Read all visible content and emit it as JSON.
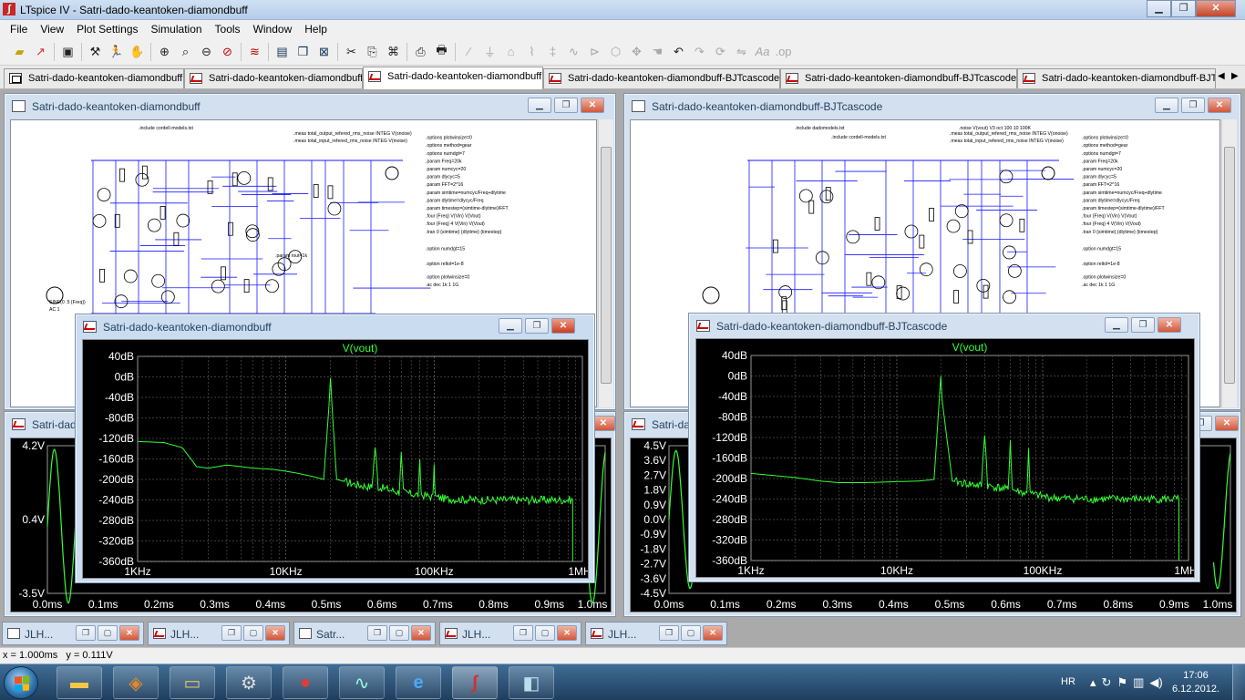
{
  "app": {
    "title": "LTspice IV - Satri-dado-keantoken-diamondbuff"
  },
  "menu": [
    "File",
    "View",
    "Plot Settings",
    "Simulation",
    "Tools",
    "Window",
    "Help"
  ],
  "toolbar": {
    "icons": [
      "open-folder-icon",
      "open-file-icon",
      "save-icon",
      "control-panel-icon",
      "run-icon",
      "halt-icon",
      "zoom-in-icon",
      "zoom-pan-icon",
      "zoom-out-icon",
      "zoom-cancel-icon",
      "autorange-icon",
      "tile-horizontal-icon",
      "cascade-icon",
      "close-window-icon",
      "cut-icon",
      "copy-icon",
      "find-icon",
      "print-setup-icon",
      "print-icon",
      "wire-icon",
      "ground-icon",
      "label-icon",
      "resistor-icon",
      "capacitor-icon",
      "inductor-icon",
      "diode-icon",
      "component-icon",
      "move-icon",
      "drag-icon",
      "undo-icon",
      "redo-icon",
      "rotate-icon",
      "mirror-icon",
      "text-icon",
      "spice-directive-icon"
    ]
  },
  "tabs": [
    {
      "label": "Satri-dado-keantoken-diamondbuff",
      "type": "sch"
    },
    {
      "label": "Satri-dado-keantoken-diamondbuff",
      "type": "plot"
    },
    {
      "label": "Satri-dado-keantoken-diamondbuff",
      "type": "plot"
    },
    {
      "label": "Satri-dado-keantoken-diamondbuff-BJTcascode",
      "type": "plot"
    },
    {
      "label": "Satri-dado-keantoken-diamondbuff-BJTcascode",
      "type": "plot"
    },
    {
      "label": "Satri-dado-keantoken-diamondbuff-BJTc",
      "type": "plot"
    }
  ],
  "windows": {
    "schematic_left": {
      "title": "Satri-dado-keantoken-diamondbuff",
      "directives": [
        ".include cordell-models.txt",
        ".meas total_output_refered_rms_noise INTEG V(onoise)",
        ".meas total_input_refered_rms_noise INTEG V(inoise)",
        ".options plotwinsize=0",
        ".options method=gear",
        ".options numdgt=7",
        ".param Freq=20k",
        ".param numcyc=20",
        ".param dlycyc=5",
        ".param FFT=2^16",
        ".param simtime=numcyc/Freq+dlytime",
        ".param dlytime=dlycyc/Freq",
        ".param timestep=(simtime-dlytime)/FFT",
        ".four {Freq} V(Vin) V(Vout)",
        ".four {Freq} 4 V(Vin) V(Vout)",
        ".tran 0 {simtime} {dlytime} {timestep}",
        ".option numdgt=15",
        ".option reltol=1e-8",
        ".option plotwinsize=0",
        ".ac dec 1k 1 1G",
        ".param rout=1k",
        "SINE(0 .5 {Freq})",
        "AC 1"
      ]
    },
    "schematic_right": {
      "title": "Satri-dado-keantoken-diamondbuff-BJTcascode",
      "directives": [
        ".include dadomodels.txt",
        ".noise V(vout) V3 oct 100 10 100K",
        ".include cordell-models.txt",
        ".meas total_output_refered_rms_noise INTEG V(onoise)",
        ".meas total_input_refered_rms_noise INTEG V(inoise)",
        ".options plotwinsize=0",
        ".options method=gear",
        ".options numdgt=7",
        ".param Freq=20k",
        ".param numcyc=20",
        ".param dlycyc=5",
        ".param FFT=2^16",
        ".param simtime=numcyc/Freq+dlytime",
        ".param dlytime=dlycyc/Freq",
        ".param timestep=(simtime-dlytime)/FFT",
        ".four {Freq} V(Vin) V(Vout)",
        ".four {Freq} 4 V(Vin) V(Vout)",
        ".tran 0 {simtime} {dlytime} {timestep}",
        ".option numdgt=15",
        ".option reltol=1e-8",
        ".option plotwinsize=0",
        ".ac dec 1k 1 1G"
      ]
    },
    "time_left": {
      "title": "Satri-dad",
      "ylabels": [
        "4.2V",
        "0.4V",
        "-3.5V"
      ],
      "xlabels": [
        "0.0ms",
        "0.1ms",
        "0.2ms",
        "0.3ms",
        "0.4ms",
        "0.5ms",
        "0.6ms",
        "0.7ms",
        "0.8ms",
        "0.9ms",
        "1.0ms"
      ]
    },
    "time_right": {
      "title": "Satri-dad",
      "ylabels": [
        "4.5V",
        "3.6V",
        "2.7V",
        "1.8V",
        "0.9V",
        "0.0V",
        "-0.9V",
        "-1.8V",
        "-2.7V",
        "-3.6V",
        "-4.5V"
      ],
      "xlabels": [
        "0.0ms",
        "0.1ms",
        "0.2ms",
        "0.3ms",
        "0.4ms",
        "0.5ms",
        "0.6ms",
        "0.7ms",
        "0.8ms",
        "0.9ms",
        "1.0ms"
      ]
    },
    "fft_left": {
      "title": "Satri-dado-keantoken-diamondbuff"
    },
    "fft_right": {
      "title": "Satri-dado-keantoken-diamondbuff-BJTcascode"
    }
  },
  "chart_data": [
    {
      "type": "line",
      "title": "V(vout)",
      "x_scale": "log",
      "xlim": [
        1000,
        1000000
      ],
      "ylim": [
        -360,
        40
      ],
      "x_tick_labels": [
        "1KHz",
        "10KHz",
        "100KHz",
        "1MHz"
      ],
      "y_tick_labels": [
        "40dB",
        "0dB",
        "-40dB",
        "-80dB",
        "-120dB",
        "-160dB",
        "-200dB",
        "-240dB",
        "-280dB",
        "-320dB",
        "-360dB"
      ],
      "grid": true,
      "series": [
        {
          "name": "V(vout)",
          "color": "#33ff33",
          "x": [
            1000,
            1500,
            2000,
            2500,
            3000,
            4000,
            5000,
            6000,
            8000,
            10000,
            12000,
            14000,
            16000,
            18000,
            19500,
            20000,
            20500,
            22000,
            30000,
            38000,
            40000,
            42000,
            50000,
            58000,
            60000,
            62000,
            70000,
            78000,
            80000,
            82000,
            90000,
            98000,
            100000,
            102000,
            120000,
            200000,
            400000,
            700000,
            860000
          ],
          "y": [
            -126,
            -128,
            -138,
            -175,
            -178,
            -172,
            -175,
            -178,
            -180,
            -184,
            -188,
            -192,
            -196,
            -200,
            -60,
            -2,
            -60,
            -200,
            -210,
            -215,
            -135,
            -215,
            -220,
            -225,
            -150,
            -225,
            -228,
            -230,
            -168,
            -230,
            -232,
            -234,
            -178,
            -234,
            -238,
            -240,
            -240,
            -240,
            -240
          ]
        }
      ]
    },
    {
      "type": "line",
      "title": "V(vout)",
      "x_scale": "log",
      "xlim": [
        1000,
        1000000
      ],
      "ylim": [
        -360,
        40
      ],
      "x_tick_labels": [
        "1KHz",
        "10KHz",
        "100KHz",
        "1MHz"
      ],
      "y_tick_labels": [
        "40dB",
        "0dB",
        "-40dB",
        "-80dB",
        "-120dB",
        "-160dB",
        "-200dB",
        "-240dB",
        "-280dB",
        "-320dB",
        "-360dB"
      ],
      "grid": true,
      "series": [
        {
          "name": "V(vout)",
          "color": "#33ff33",
          "x": [
            1000,
            2000,
            3000,
            4000,
            6000,
            8000,
            10000,
            14000,
            18000,
            19500,
            20000,
            20500,
            24000,
            30000,
            38000,
            40000,
            42000,
            50000,
            58000,
            60000,
            62000,
            70000,
            78000,
            80000,
            82000,
            100000,
            120000,
            200000,
            400000,
            700000,
            860000
          ],
          "y": [
            -190,
            -198,
            -205,
            -208,
            -208,
            -207,
            -206,
            -205,
            -202,
            -50,
            0,
            -50,
            -205,
            -210,
            -214,
            -110,
            -214,
            -218,
            -222,
            -125,
            -222,
            -226,
            -230,
            -140,
            -230,
            -235,
            -238,
            -240,
            -240,
            -240,
            -240
          ]
        }
      ]
    },
    {
      "type": "line",
      "title": "",
      "xlim": [
        0,
        1.0
      ],
      "x_tick_labels": [
        "0.0ms",
        "0.1ms",
        "0.2ms",
        "0.3ms",
        "0.4ms",
        "0.5ms",
        "0.6ms",
        "0.7ms",
        "0.8ms",
        "0.9ms",
        "1.0ms"
      ],
      "y_tick_labels": [
        "4.2V",
        "0.4V",
        "-3.5V"
      ],
      "ylim": [
        -3.5,
        4.2
      ],
      "series": [
        {
          "name": "V(vout)",
          "color": "#33ff33",
          "x": [
            0.0,
            0.0125,
            0.025,
            0.0375,
            0.05
          ],
          "y": [
            0.4,
            4.0,
            0.4,
            -3.3,
            0.4
          ]
        }
      ]
    },
    {
      "type": "line",
      "title": "",
      "xlim": [
        0,
        1.0
      ],
      "x_tick_labels": [
        "0.0ms",
        "0.1ms",
        "0.2ms",
        "0.3ms",
        "0.4ms",
        "0.5ms",
        "0.6ms",
        "0.7ms",
        "0.8ms",
        "0.9ms",
        "1.0ms"
      ],
      "y_tick_labels": [
        "4.5V",
        "3.6V",
        "2.7V",
        "1.8V",
        "0.9V",
        "0.0V",
        "-0.9V",
        "-1.8V",
        "-2.7V",
        "-3.6V",
        "-4.5V"
      ],
      "ylim": [
        -4.5,
        4.5
      ],
      "series": [
        {
          "name": "V(vout)",
          "color": "#33ff33",
          "x": [
            0.0,
            0.0125,
            0.025,
            0.0375,
            0.05
          ],
          "y": [
            0.0,
            4.2,
            0.0,
            -4.2,
            0.0
          ]
        }
      ]
    }
  ],
  "minimized": [
    {
      "label": "JLH...",
      "type": "sch"
    },
    {
      "label": "JLH...",
      "type": "plot"
    },
    {
      "label": "Satr...",
      "type": "sch"
    },
    {
      "label": "JLH...",
      "type": "plot"
    },
    {
      "label": "JLH...",
      "type": "plot"
    }
  ],
  "status": {
    "text": "x = 1.000ms   y = 0.111V"
  },
  "taskbar": {
    "lang": "HR",
    "time": "17:06",
    "date": "6.12.2012."
  }
}
